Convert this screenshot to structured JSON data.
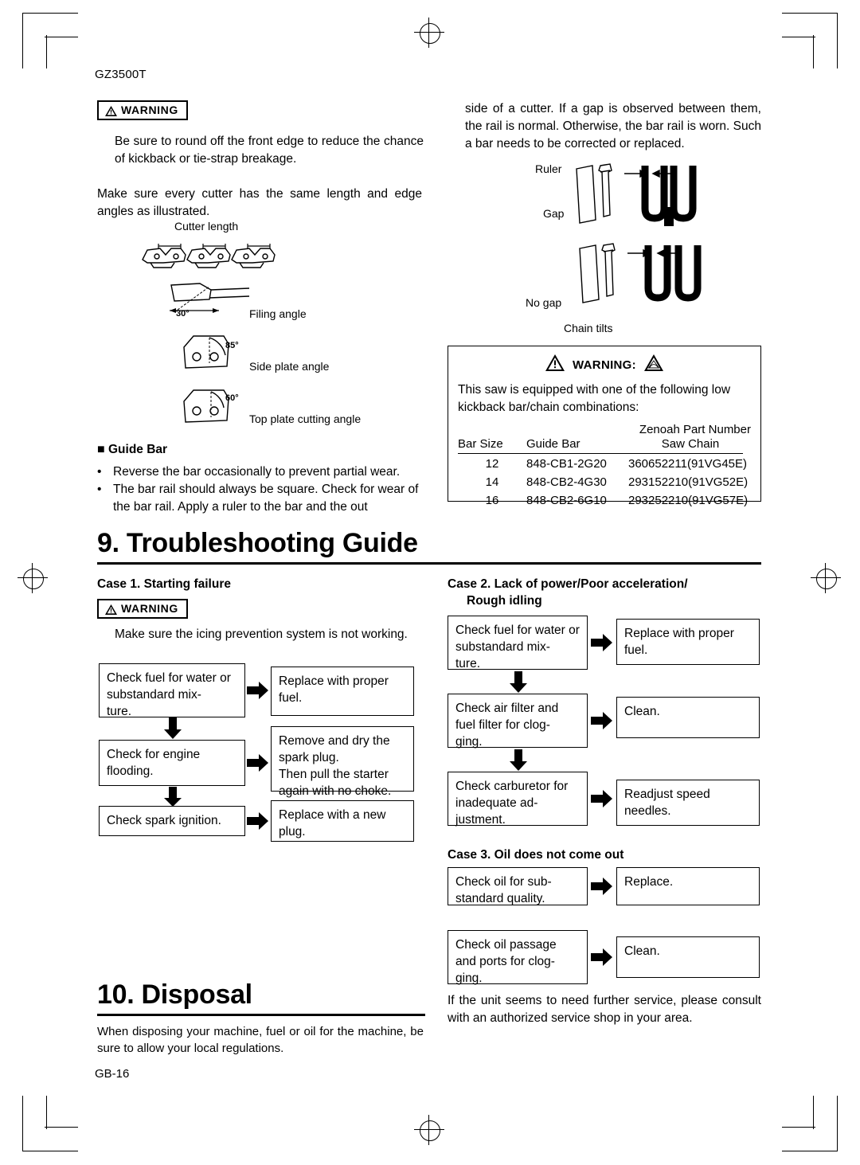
{
  "header": {
    "model": "GZ3500T",
    "page_number": "GB-16"
  },
  "warning_label": "WARNING",
  "left": {
    "warning1_text": "Be sure to round off the front edge to reduce the chance of kickback or tie-strap breakage.",
    "para1": "Make sure every cutter has the same length and edge angles as illustrated.",
    "fig_labels": {
      "cutter_length": "Cutter length",
      "filing_angle": "Filing angle",
      "filing_angle_value": "30°",
      "side_plate_angle": "Side plate angle",
      "side_plate_value": "85°",
      "top_plate_angle": "Top plate cutting angle",
      "top_plate_value": "60°"
    },
    "guide_bar_heading": "Guide Bar",
    "guide_bar_bullets": [
      "Reverse the bar occasionally to prevent partial wear.",
      "The bar rail should always be square. Check for wear of the bar rail. Apply a ruler to the bar and the out"
    ]
  },
  "right": {
    "top_para": "side of a cutter. If a gap is observed between them, the rail is normal. Otherwise, the bar rail is worn. Such a bar needs to be corrected or replaced.",
    "fig_labels": {
      "ruler": "Ruler",
      "gap": "Gap",
      "no_gap": "No gap",
      "chain_tilts": "Chain tilts"
    },
    "warning_box": {
      "title": "WARNING:",
      "body": "This saw is equipped with one of the following low kickback bar/chain combinations:",
      "table_title": "Zenoah Part Number",
      "headers": [
        "Bar Size",
        "Guide Bar",
        "Saw Chain"
      ],
      "rows": [
        [
          "12",
          "848-CB1-2G20",
          "360652211(91VG45E)"
        ],
        [
          "14",
          "848-CB2-4G30",
          "293152210(91VG52E)"
        ],
        [
          "16",
          "848-CB2-6G10",
          "293252210(91VG57E)"
        ]
      ]
    }
  },
  "section9": {
    "title": "9. Troubleshooting Guide",
    "case1": {
      "heading": "Case 1.  Starting failure",
      "warning_text": "Make sure the icing prevention system is not working.",
      "rows": [
        {
          "left": "Check fuel for water or substandard mix-\nture.",
          "right": "Replace with proper fuel."
        },
        {
          "left": "Check  for  engine flooding.",
          "right": "Remove and dry the spark plug.\nThen pull the starter again with no choke."
        },
        {
          "left": "Check spark ignition.",
          "right": "Replace with a new plug."
        }
      ]
    },
    "case2": {
      "heading": "Case 2.  Lack of power/Poor acceleration/",
      "heading2": "Rough idling",
      "rows": [
        {
          "left": "Check fuel for water or substandard mix-\nture.",
          "right": "Replace with proper fuel."
        },
        {
          "left": "Check air filter and fuel  filter  for  clog-\nging.",
          "right": "Clean."
        },
        {
          "left": "Check  carburetor for inadequate ad-\njustment.",
          "right": "Readjust speed needles."
        }
      ]
    },
    "case3": {
      "heading": "Case 3.  Oil does not come out",
      "rows": [
        {
          "left": "Check oil for sub-\nstandard quality.",
          "right": "Replace."
        },
        {
          "left": "Check oil passage and ports for clog-\nging.",
          "right": "Clean."
        }
      ]
    },
    "closing": "If the unit seems to need further service, please consult with an authorized service shop in your area."
  },
  "section10": {
    "title": "10. Disposal",
    "body": "When disposing your machine, fuel or oil for the machine, be sure to allow your local regulations."
  }
}
